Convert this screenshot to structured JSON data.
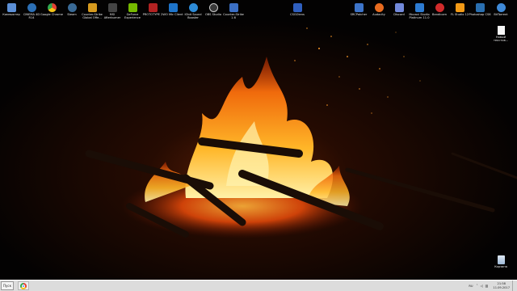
{
  "desktop": {
    "icons_left": [
      {
        "label": "Компьютер",
        "icon": "computer-icon",
        "color": "#5c8fd6"
      },
      {
        "label": "CINEMA 4D R14",
        "icon": "cinema4d-icon",
        "color": "#2c6fb5"
      },
      {
        "label": "Google Chrome",
        "icon": "chrome-icon",
        "color": "#e0a520"
      },
      {
        "label": "Steam",
        "icon": "steam-icon",
        "color": "#3a6a96"
      },
      {
        "label": "Counter-Strike Global Offe...",
        "icon": "csgo-icon",
        "color": "#d69a1e"
      },
      {
        "label": "MSI Afterburner",
        "icon": "msi-afterburner-icon",
        "color": "#444444"
      },
      {
        "label": "GeForce Experience",
        "icon": "geforce-icon",
        "color": "#76b900"
      },
      {
        "label": "PROTOTYPE 2",
        "icon": "prototype-icon",
        "color": "#b22222"
      },
      {
        "label": "WO Mic Client",
        "icon": "wo-mic-icon",
        "color": "#1e74c9"
      },
      {
        "label": "IObit Sound Booster",
        "icon": "sound-booster-icon",
        "color": "#2d8ad6"
      },
      {
        "label": "OBS Studio",
        "icon": "obs-icon",
        "color": "#3a3a3a"
      },
      {
        "label": "Counter-Strike 1.6",
        "icon": "cs16-icon",
        "color": "#3b6fc4"
      }
    ],
    "icon_center": {
      "label": "CSGOlens",
      "icon": "csgolens-icon",
      "color": "#2f5fbf"
    },
    "icons_right": [
      {
        "label": "SRCPatcher",
        "icon": "srcpatcher-icon",
        "color": "#3d74c9"
      },
      {
        "label": "Audacity",
        "icon": "audacity-icon",
        "color": "#e86b1f"
      },
      {
        "label": "Discord",
        "icon": "discord-icon",
        "color": "#7289da"
      },
      {
        "label": "Movavi Studio Platinum 11.0",
        "icon": "movavi-icon",
        "color": "#2d7bd1"
      },
      {
        "label": "Bandicam",
        "icon": "bandicam-icon",
        "color": "#d12b2b"
      },
      {
        "label": "FL Studio 12",
        "icon": "fl-studio-icon",
        "color": "#f39a16"
      },
      {
        "label": "Photoshop CS6",
        "icon": "photoshop-icon",
        "color": "#2a6fb0"
      },
      {
        "label": "BitTorrent",
        "icon": "bittorrent-icon",
        "color": "#3f8ad8"
      }
    ],
    "new_file": {
      "label": "Новый текстов...",
      "icon": "text-document-icon",
      "color": "#f7f7f7"
    },
    "recycle_bin": {
      "label": "Корзина",
      "icon": "recycle-bin-icon",
      "color": "#9db8d6"
    }
  },
  "taskbar": {
    "start_label": "Пуск",
    "pinned": [
      {
        "icon": "chrome-icon"
      }
    ],
    "language": "RU",
    "tray_icons": [
      "chevron-up-icon",
      "speaker-icon",
      "network-icon"
    ],
    "time": "21:58",
    "date": "11.09.2017"
  }
}
